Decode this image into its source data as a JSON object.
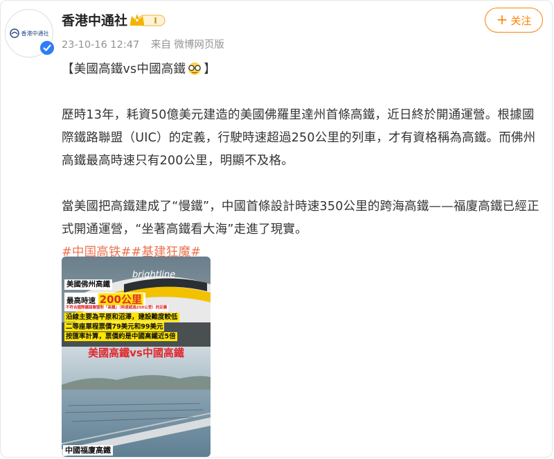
{
  "post": {
    "user": {
      "name": "香港中通社",
      "avatar_text": "香港中通社",
      "badge_label": "I",
      "verified": true
    },
    "meta": {
      "timestamp": "23-10-16 12:47",
      "source": "来自 微博网页版"
    },
    "follow_button": {
      "label": "关注",
      "icon": "plus-icon"
    },
    "content": {
      "title": "【美國高鐵vs中國高鐵",
      "title_close": "】",
      "title_emoji": "glasses-emoji",
      "paragraph1": "歷時13年，耗資50億美元建造的美國佛羅里達州首條高鐵，近日終於開通運營。根據國際鐵路聯盟（UIC）的定義，行駛時速超過250公里的列車，才有資格稱為高鐵。而佛州高鐵最高時速只有200公里，明顯不及格。",
      "paragraph2": "當美國把高鐵建成了“慢鐵”，中國首條設計時速350公里的跨海高鐵——福廈高鐵已經正式開通運營，“坐著高鐵看大海”走進了現實。",
      "hashtags": [
        "#中国高铁#",
        "#基建狂魔#"
      ]
    },
    "image": {
      "train_brand": "brightline",
      "tag_us": "美國佛州高鐵",
      "speed_prefix": "最高時速",
      "speed_value": "200公里",
      "note_uic": "不符合國際鐵路聯盟對「高鐵」（時速超過250公里）的定義",
      "line1": "沿線主要為平原和沼澤，建設難度較低",
      "line2": "二等座單程票價79美元和99美元",
      "line3": "按匯率計算，票價約是中國高鐵近5倍",
      "headline": "美國高鐵vs中國高鐵",
      "tag_cn": "中國福廈高鐵"
    },
    "colors": {
      "accent": "#ff8200",
      "hashtag": "#eb7350",
      "meta": "#939393",
      "verified": "#2f7cf6",
      "headline_red": "#e1282e"
    }
  }
}
